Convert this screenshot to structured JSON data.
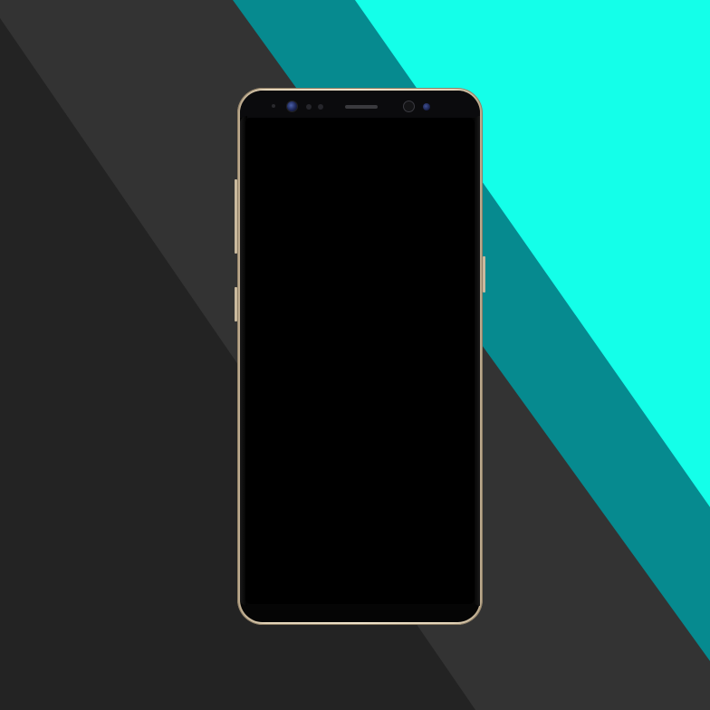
{
  "scene": {
    "background_colors": {
      "dark": "#232323",
      "mid": "#333333",
      "teal": "#068a8f",
      "cyan": "#14ffe9"
    },
    "device": {
      "frame_color": "#e2d3b8",
      "screen_color": "#000000",
      "screen_state": "off",
      "icons": [
        "front-camera-icon",
        "earpiece-speaker-icon",
        "iris-scanner-icon",
        "proximity-sensor-icon"
      ]
    }
  }
}
